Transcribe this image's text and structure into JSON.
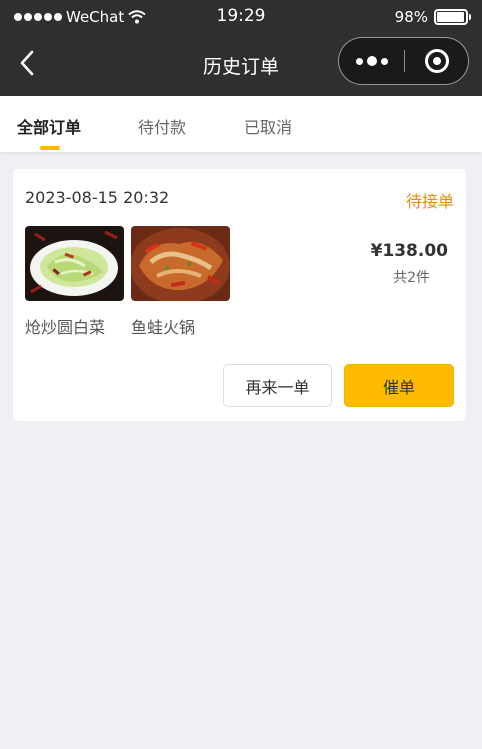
{
  "status_bar": {
    "carrier": "WeChat",
    "time": "19:29",
    "battery": "98%",
    "battery_level": 0.98
  },
  "nav": {
    "title": "历史订单"
  },
  "tabs": [
    {
      "label": "全部订单",
      "active": true
    },
    {
      "label": "待付款",
      "active": false
    },
    {
      "label": "已取消",
      "active": false
    }
  ],
  "order": {
    "datetime": "2023-08-15 20:32",
    "status": "待接单",
    "items": [
      {
        "name": "炝炒圆白菜",
        "image": "dish-cabbage"
      },
      {
        "name": "鱼蛙火锅",
        "image": "dish-fish-frog-hotpot"
      }
    ],
    "price": "¥138.00",
    "count": "共2件",
    "reorder_label": "再来一单",
    "urge_label": "催单"
  },
  "colors": {
    "header_bg": "#2f2f2f",
    "accent": "#ffbb00",
    "status_orange": "#f0890a",
    "page_bg": "#efeff4"
  }
}
